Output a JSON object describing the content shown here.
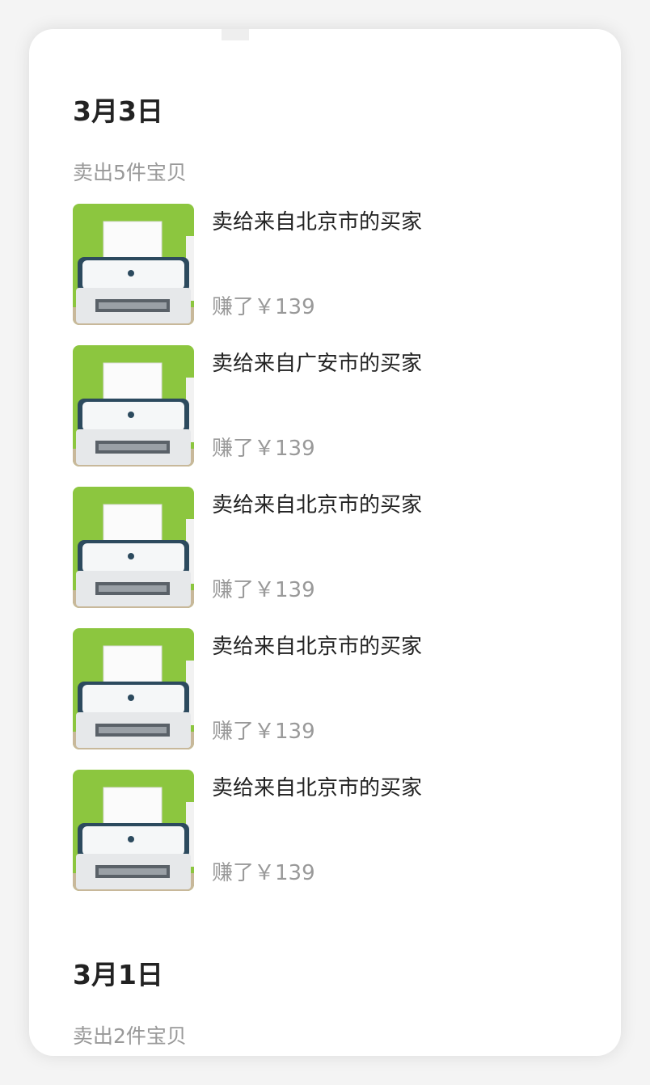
{
  "sections": [
    {
      "date": "3月3日",
      "summary": "卖出5件宝贝",
      "items": [
        {
          "buyer": "卖给来自北京市的买家",
          "earned": "赚了￥139",
          "thumbnail_icon": "printer-photo"
        },
        {
          "buyer": "卖给来自广安市的买家",
          "earned": "赚了￥139",
          "thumbnail_icon": "printer-photo"
        },
        {
          "buyer": "卖给来自北京市的买家",
          "earned": "赚了￥139",
          "thumbnail_icon": "printer-photo"
        },
        {
          "buyer": "卖给来自北京市的买家",
          "earned": "赚了￥139",
          "thumbnail_icon": "printer-photo"
        },
        {
          "buyer": "卖给来自北京市的买家",
          "earned": "赚了￥139",
          "thumbnail_icon": "printer-photo"
        }
      ]
    },
    {
      "date": "3月1日",
      "summary": "卖出2件宝贝",
      "items": []
    }
  ],
  "colors": {
    "background": "#f4f4f4",
    "card": "#ffffff",
    "primary_text": "#222222",
    "secondary_text": "#999999",
    "thumbnail_wall": "#8cc63f",
    "printer_body": "#e8eef0",
    "printer_trim": "#2c4a5e"
  }
}
